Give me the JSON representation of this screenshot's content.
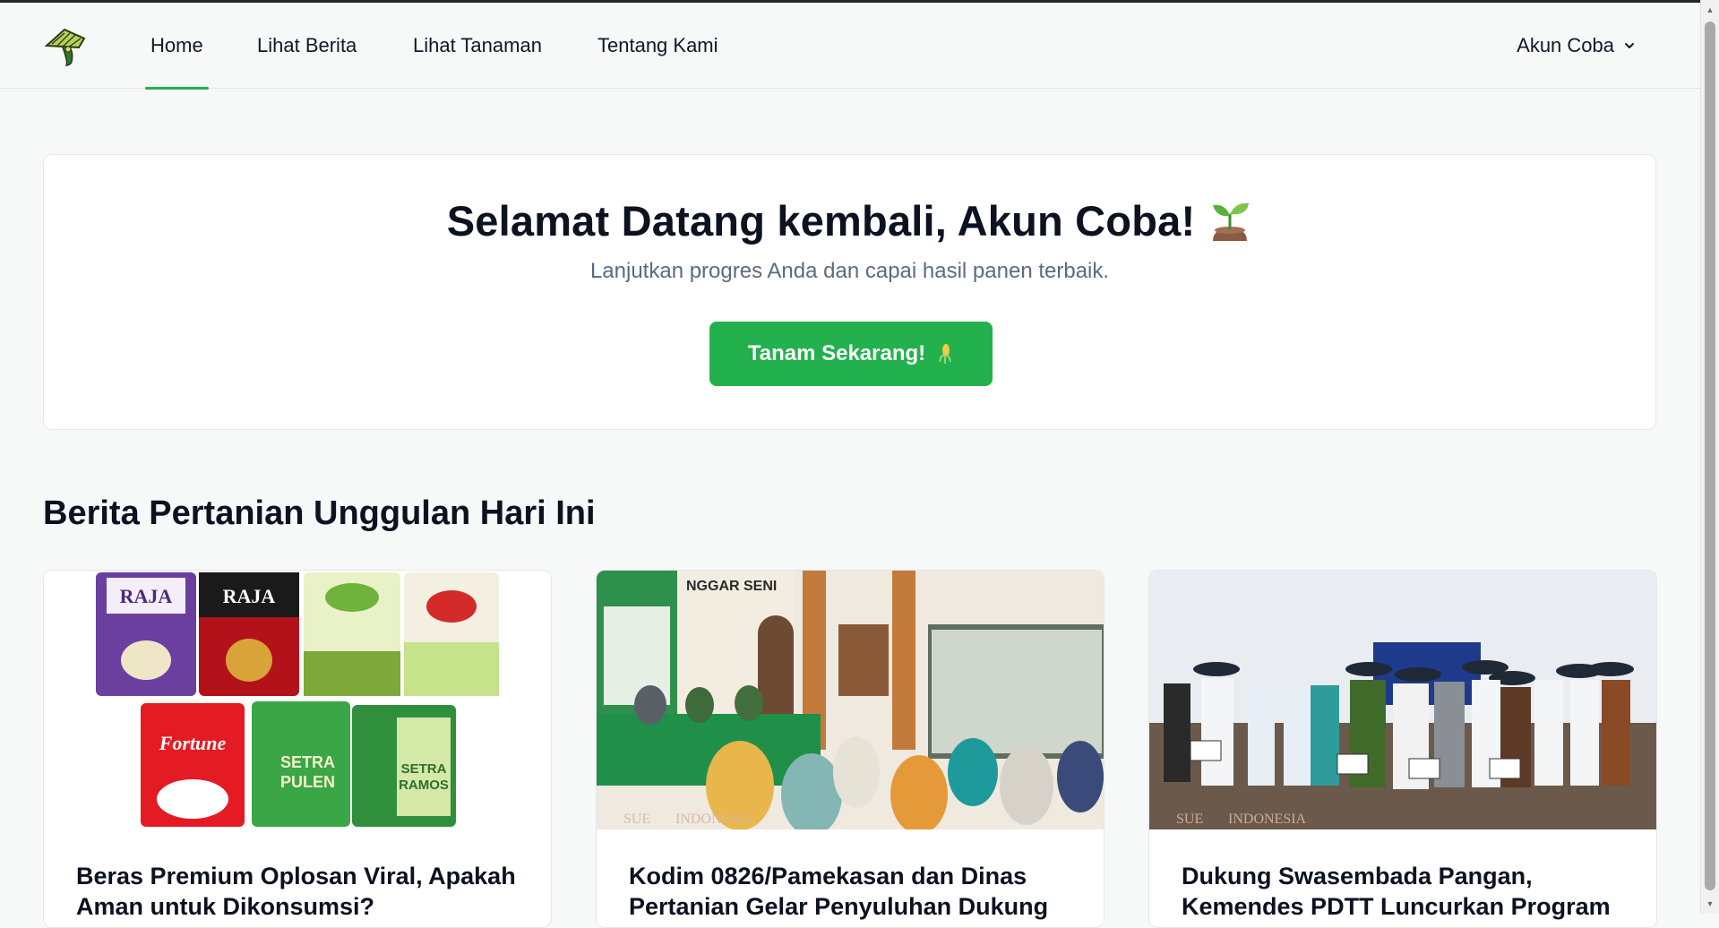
{
  "nav": {
    "links": [
      {
        "label": "Home",
        "active": true
      },
      {
        "label": "Lihat Berita",
        "active": false
      },
      {
        "label": "Lihat Tanaman",
        "active": false
      },
      {
        "label": "Tentang Kami",
        "active": false
      }
    ],
    "account_label": "Akun Coba"
  },
  "welcome": {
    "title": "Selamat Datang kembali, Akun Coba!",
    "subtitle": "Lanjutkan progres Anda dan capai hasil panen terbaik.",
    "cta_label": "Tanam Sekarang!"
  },
  "news": {
    "section_title": "Berita Pertanian Unggulan Hari Ini",
    "cards": [
      {
        "title": "Beras Premium Oplosan Viral, Apakah Aman untuk Dikonsumsi?",
        "image": "rice-bags-photo"
      },
      {
        "title": "Kodim 0826/Pamekasan dan Dinas Pertanian Gelar Penyuluhan Dukung",
        "image": "meeting-hall-photo",
        "watermark": "INDONESIA"
      },
      {
        "title": "Dukung Swasembada Pangan, Kemendes PDTT Luncurkan Program",
        "image": "field-ceremony-photo",
        "watermark": "INDONESIA"
      }
    ]
  },
  "colors": {
    "accent": "#22b14c",
    "text": "#0b1220",
    "muted": "#5b6b80",
    "background": "#f7f8f8"
  }
}
